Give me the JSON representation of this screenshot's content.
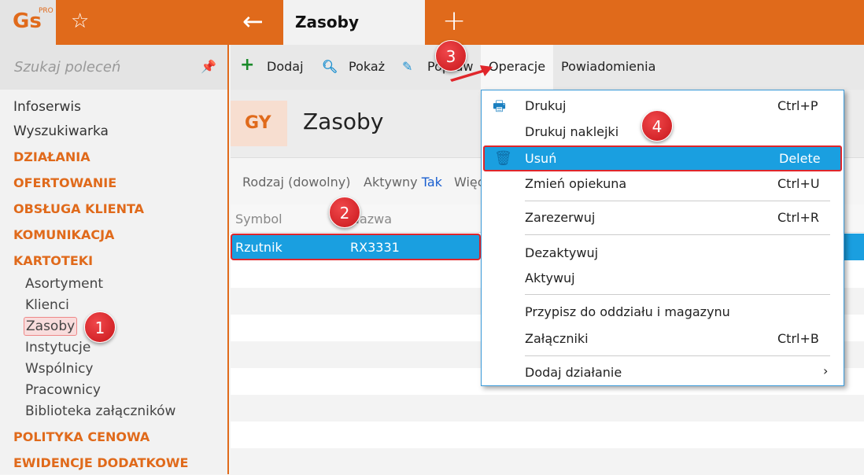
{
  "app": {
    "logo": "Gs",
    "logo_sup": "PRO",
    "tab": "Zasoby"
  },
  "sidebar": {
    "search_placeholder": "Szukaj poleceń",
    "items": [
      "Infoserwis",
      "Wyszukiwarka"
    ],
    "sections": [
      "DZIAŁANIA",
      "OFERTOWANIE",
      "OBSŁUGA KLIENTA",
      "KOMUNIKACJA",
      "KARTOTEKI"
    ],
    "sub": [
      "Asortyment",
      "Klienci",
      "Zasoby",
      "Instytucje",
      "Wspólnicy",
      "Pracownicy",
      "Biblioteka załączników"
    ],
    "sections2": [
      "POLITYKA CENOWA",
      "EWIDENCJE DODATKOWE"
    ]
  },
  "toolbar": {
    "add": "Dodaj",
    "show": "Pokaż",
    "edit": "Popraw",
    "operations": "Operacje",
    "notifications": "Powiadomienia"
  },
  "header": {
    "badge": "GY",
    "title": "Zasoby"
  },
  "filters": {
    "kind": "Rodzaj (dowolny)",
    "active_label": "Aktywny",
    "active_value": "Tak",
    "more": "Więcej"
  },
  "grid": {
    "columns": [
      "Symbol",
      "Nazwa"
    ],
    "rows": [
      {
        "symbol": "Rzutnik",
        "name": "RX3331"
      }
    ]
  },
  "menu": {
    "items": [
      {
        "label": "Drukuj",
        "shortcut": "Ctrl+P"
      },
      {
        "label": "Drukuj naklejki",
        "shortcut": ""
      },
      {
        "label": "Usuń",
        "shortcut": "Delete"
      },
      {
        "label": "Zmień opiekuna",
        "shortcut": "Ctrl+U"
      },
      {
        "label": "Zarezerwuj",
        "shortcut": "Ctrl+R"
      },
      {
        "label": "Dezaktywuj",
        "shortcut": ""
      },
      {
        "label": "Aktywuj",
        "shortcut": ""
      },
      {
        "label": "Przypisz do oddziału i magazynu",
        "shortcut": ""
      },
      {
        "label": "Załączniki",
        "shortcut": "Ctrl+B"
      },
      {
        "label": "Dodaj działanie",
        "shortcut": ""
      }
    ]
  },
  "annotations": [
    "1",
    "2",
    "3",
    "4"
  ],
  "colors": {
    "accent": "#e06a1b",
    "selection": "#1a9fe0",
    "annotation": "#e0262b"
  }
}
